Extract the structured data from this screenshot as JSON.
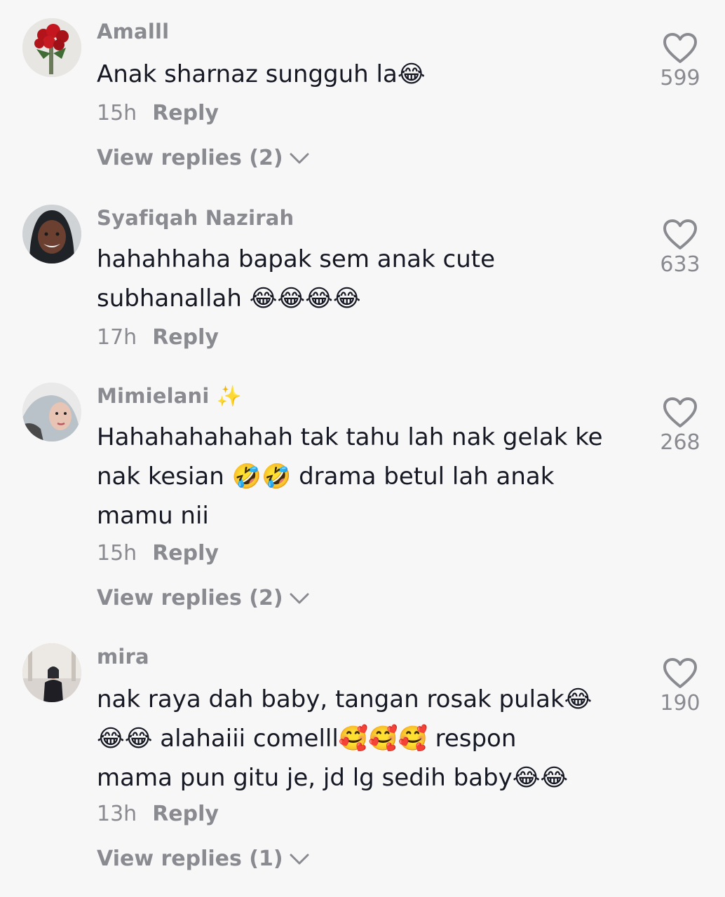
{
  "comments": [
    {
      "username": "Amalll",
      "lines": [
        "Anak sharnaz sungguh la😂"
      ],
      "time": "15h",
      "reply_label": "Reply",
      "view_replies": "View replies (2)",
      "likes": "599",
      "avatar_icon": "roses-avatar"
    },
    {
      "username": "Syafiqah Nazirah",
      "lines": [
        "hahahhaha bapak sem anak cute",
        "subhanallah 😂😂😂😂"
      ],
      "time": "17h",
      "reply_label": "Reply",
      "view_replies": "",
      "likes": "633",
      "avatar_icon": "hijab-woman-avatar"
    },
    {
      "username": "Mimielani ✨",
      "lines": [
        "Hahahahahahah tak tahu lah nak gelak ke",
        "nak kesian 🤣🤣 drama betul lah anak",
        "mamu nii"
      ],
      "time": "15h",
      "reply_label": "Reply",
      "view_replies": "View replies (2)",
      "likes": "268",
      "avatar_icon": "hijab-selfie-avatar"
    },
    {
      "username": "mira",
      "lines": [
        "nak raya dah baby, tangan rosak pulak😂",
        "😂😂 alahaiii comelll🥰🥰🥰 respon",
        "mama pun gitu je, jd lg sedih baby😂😂"
      ],
      "time": "13h",
      "reply_label": "Reply",
      "view_replies": "View replies (1)",
      "likes": "190",
      "avatar_icon": "room-portrait-avatar"
    }
  ],
  "colors": {
    "background": "#f7f7f7",
    "primary_text": "#161823",
    "secondary_text": "#8a8b91"
  }
}
